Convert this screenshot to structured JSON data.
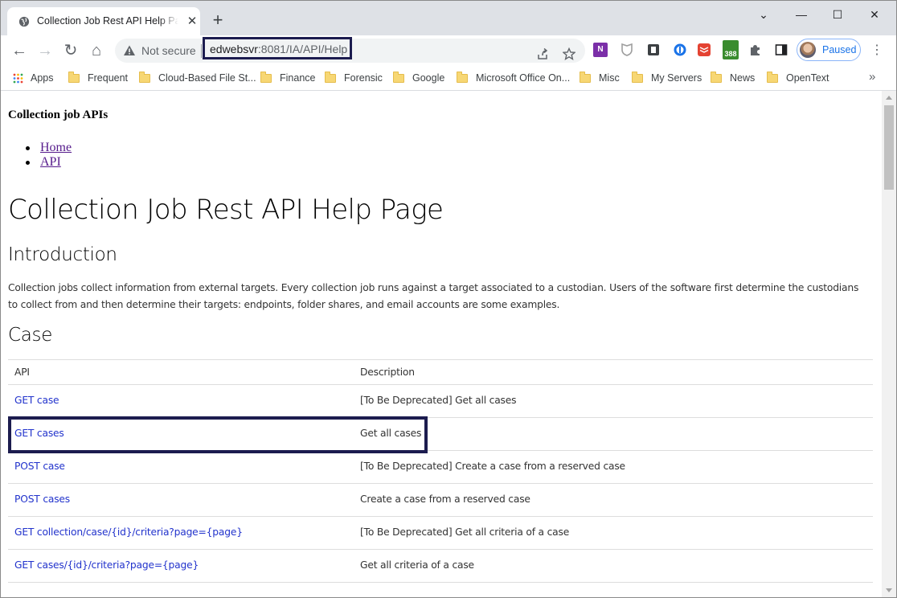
{
  "tab": {
    "title": "Collection Job Rest API Help Page",
    "close": "✕",
    "new_tab": "+"
  },
  "window_controls": {
    "minimize": "—",
    "maximize": "☐",
    "close": "✕",
    "dropdown": "⌄"
  },
  "toolbar": {
    "back": "←",
    "forward": "→",
    "reload": "↻",
    "home": "⌂",
    "security_label": "Not secure",
    "url_host": "edwebsvr",
    "url_rest": ":8081/IA/API/Help",
    "profile_label": "Paused",
    "extensions": [
      {
        "icon": "onenote-icon",
        "label": "N",
        "color": "#7b2fa8"
      },
      {
        "icon": "shield-extension-icon",
        "label": "",
        "color": "#9e9e9e"
      },
      {
        "icon": "document-extension-icon",
        "label": "",
        "color": "#3c4043"
      },
      {
        "icon": "password-extension-icon",
        "label": "",
        "color": "#1a73e8"
      },
      {
        "icon": "todoist-icon",
        "label": "",
        "color": "#e44332"
      },
      {
        "icon": "counter-extension-icon",
        "label": "388",
        "color": "#3a8c2e"
      },
      {
        "icon": "puzzle-icon",
        "label": "",
        "color": "#5f6368"
      }
    ]
  },
  "bookmarks": [
    {
      "label": "Apps",
      "icon": "apps-grid-icon"
    },
    {
      "label": "Frequent",
      "icon": "folder-icon"
    },
    {
      "label": "Cloud-Based File St...",
      "icon": "folder-icon"
    },
    {
      "label": "Finance",
      "icon": "folder-icon"
    },
    {
      "label": "Forensic",
      "icon": "folder-icon"
    },
    {
      "label": "Google",
      "icon": "folder-icon"
    },
    {
      "label": "Microsoft Office On...",
      "icon": "folder-icon"
    },
    {
      "label": "Misc",
      "icon": "folder-icon"
    },
    {
      "label": "My Servers",
      "icon": "folder-icon"
    },
    {
      "label": "News",
      "icon": "folder-icon"
    },
    {
      "label": "OpenText",
      "icon": "folder-icon"
    }
  ],
  "page": {
    "site_heading": "Collection job APIs",
    "nav": [
      "Home",
      "API"
    ],
    "title": "Collection Job Rest API Help Page",
    "intro_heading": "Introduction",
    "intro_text": "Collection jobs collect information from external targets. Every collection job runs against a target associated to a custodian. Users of the software first determine the custodians to collect from and then determine their targets: endpoints, folder shares, and email accounts are some examples.",
    "section_heading": "Case",
    "table": {
      "headers": [
        "API",
        "Description"
      ],
      "rows": [
        {
          "api": "GET case",
          "description": "[To Be Deprecated] Get all cases"
        },
        {
          "api": "GET cases",
          "description": "Get all cases"
        },
        {
          "api": "POST case",
          "description": "[To Be Deprecated] Create a case from a reserved case"
        },
        {
          "api": "POST cases",
          "description": "Create a case from a reserved case"
        },
        {
          "api": "GET collection/case/{id}/criteria?page={page}",
          "description": "[To Be Deprecated] Get all criteria of a case"
        },
        {
          "api": "GET cases/{id}/criteria?page={page}",
          "description": "Get all criteria of a case"
        }
      ]
    }
  }
}
